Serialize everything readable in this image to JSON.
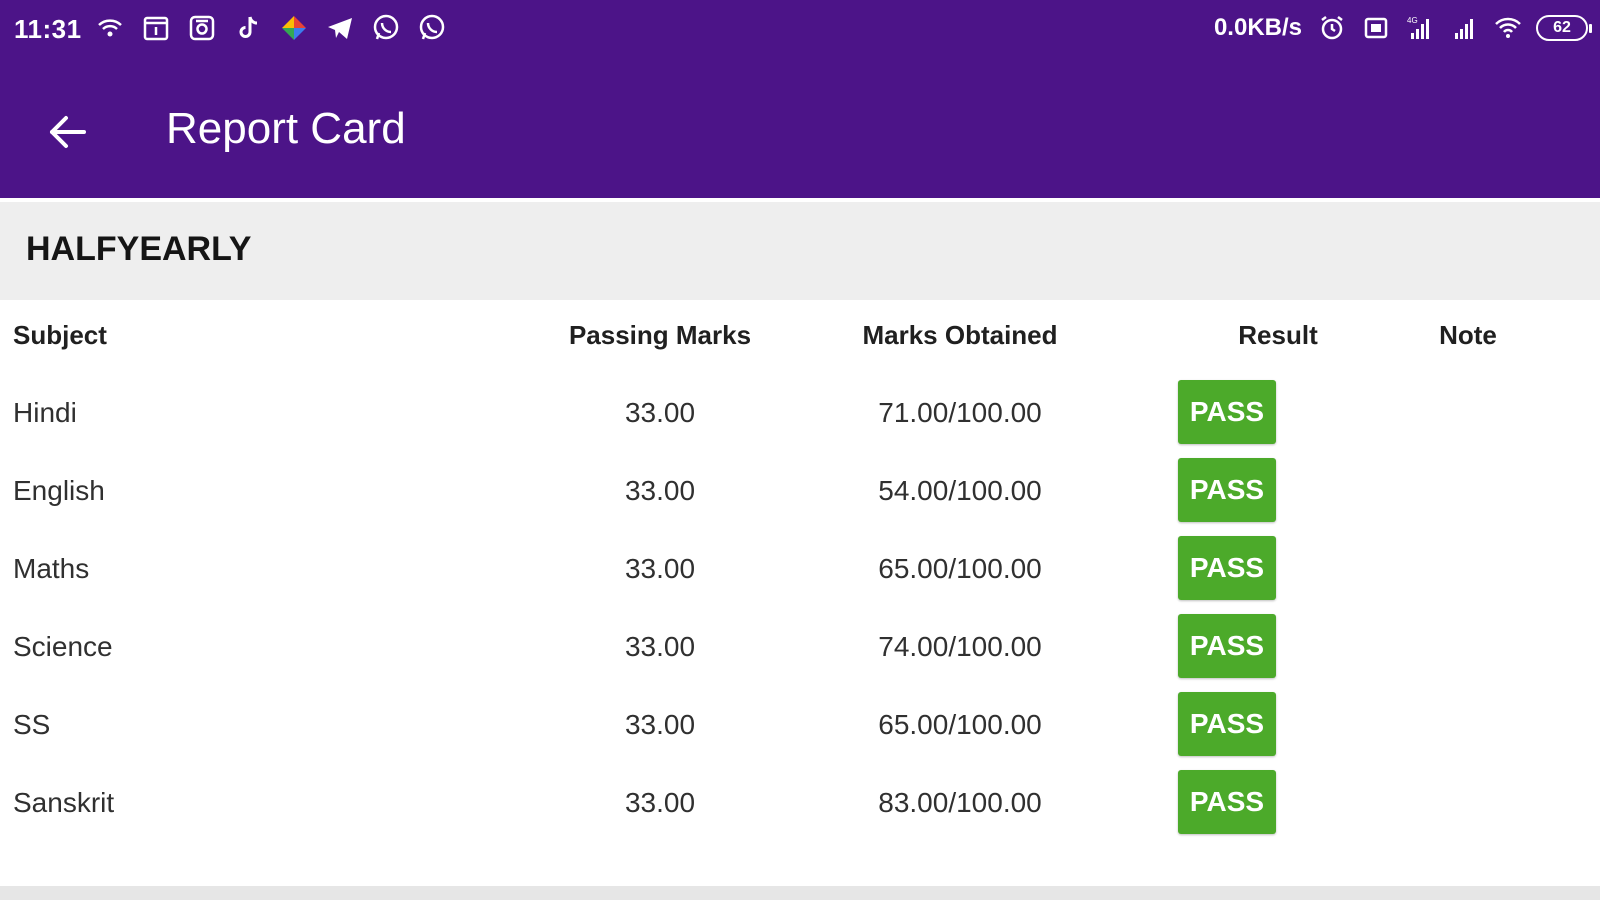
{
  "status_bar": {
    "time": "11:31",
    "left_icons": [
      "wifi-calling-icon",
      "calendar-icon",
      "app-icon",
      "tiktok-icon",
      "photos-icon",
      "telegram-icon",
      "whatsapp-icon",
      "whatsapp-icon"
    ],
    "network_speed": "0.0KB/s",
    "battery": "62",
    "right_icons": [
      "alarm-icon",
      "sim-icon",
      "signal-4g-icon",
      "signal-icon",
      "wifi-icon",
      "battery-icon"
    ]
  },
  "app_bar": {
    "back_icon": "arrow-left-icon",
    "title": "Report Card"
  },
  "exam": {
    "name": "HALFYEARLY"
  },
  "table": {
    "headers": {
      "subject": "Subject",
      "passing": "Passing Marks",
      "obtained": "Marks Obtained",
      "result": "Result",
      "note": "Note"
    },
    "rows": [
      {
        "subject": "Hindi",
        "passing": "33.00",
        "obtained": "71.00/100.00",
        "result": "PASS",
        "note": ""
      },
      {
        "subject": "English",
        "passing": "33.00",
        "obtained": "54.00/100.00",
        "result": "PASS",
        "note": ""
      },
      {
        "subject": "Maths",
        "passing": "33.00",
        "obtained": "65.00/100.00",
        "result": "PASS",
        "note": ""
      },
      {
        "subject": "Science",
        "passing": "33.00",
        "obtained": "74.00/100.00",
        "result": "PASS",
        "note": ""
      },
      {
        "subject": "SS",
        "passing": "33.00",
        "obtained": "65.00/100.00",
        "result": "PASS",
        "note": ""
      },
      {
        "subject": "Sanskrit",
        "passing": "33.00",
        "obtained": "83.00/100.00",
        "result": "PASS",
        "note": ""
      }
    ]
  },
  "colors": {
    "app_bar": "#4c1488",
    "pass_badge": "#4caa2a",
    "section_header_bg": "#eeeeee"
  }
}
